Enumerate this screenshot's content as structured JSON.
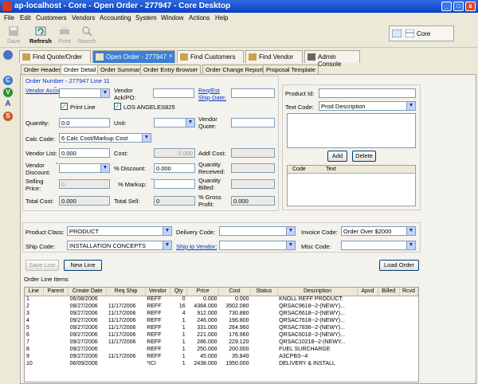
{
  "window": {
    "title": "ap-localhost - Core - Open Order - 277947 - Core Desktop"
  },
  "menu": [
    "File",
    "Edit",
    "Customers",
    "Vendors",
    "Accounting",
    "System",
    "Window",
    "Actions",
    "Help"
  ],
  "toolbar": {
    "save": "Save",
    "refresh": "Refresh",
    "print": "Print",
    "search": "Search",
    "company": "Core"
  },
  "doc_tabs": [
    "Find Quote/Order",
    "Open Order - 277947",
    "Find Customers",
    "Find Vendor",
    "Admin Console"
  ],
  "sub_tabs": [
    "Order Header",
    "Order Detail",
    "Order Summary",
    "Order Entry Browser",
    "Order Change Report",
    "Proposal Template"
  ],
  "detail": {
    "order_number": "Order Number - 277947 Line 11",
    "vendor_account_label": "Vendor Account:",
    "vendor_ackpo_label": "Vendor Ack/PO:",
    "req_ship_label": "Req/Est Ship Date:",
    "print_line_label": "Print Line",
    "los_angeles_label": "LOS ANGELES825",
    "quantity_label": "Quantity:",
    "quantity_value": "0.0",
    "unit_label": "Unit:",
    "vendor_quote_label": "Vendor Quote:",
    "calc_code_label": "Calc Code:",
    "calc_code_value": "6 Calc Cost/Markup Cost",
    "vendor_list_label": "Vendor List:",
    "vendor_list_value": "0.000",
    "cost_label": "Cost:",
    "cost_value": "0.000",
    "addl_cost_label": "Addl Cost:",
    "vendor_discount_label": "Vendor Discount:",
    "pct_discount_label": "% Discount:",
    "pct_discount_value": "0.000",
    "qty_received_label": "Quantity Received:",
    "selling_price_label": "Selling Price:",
    "selling_price_value": "0.",
    "pct_markup_label": "% Markup:",
    "qty_billed_label": "Quantity Billed:",
    "total_cost_label": "Total Cost:",
    "total_cost_value": "0.000",
    "total_sell_label": "Total Sell:",
    "total_sell_value": "0",
    "gross_profit_label": "% Gross Profit:",
    "gross_profit_value": "0.000",
    "product_id_label": "Product Id:",
    "text_code_label": "Text Code:",
    "text_code_value": "Prod Description",
    "add_button": "Add",
    "delete_button": "Delete",
    "code_col": "Code",
    "text_col": "Text",
    "product_class_label": "Product Class:",
    "product_class_value": "PRODUCT",
    "delivery_code_label": "Delivery Code:",
    "invoice_code_label": "Invoice Code:",
    "invoice_code_value": "Order Over $2000",
    "ship_code_label": "Ship Code:",
    "ship_code_value": "INSTALLATION CONCEPTS",
    "ship_to_vendor_label": "Ship to Vendor:",
    "misc_code_label": "Misc Code:",
    "save_line": "Save Line",
    "new_line": "New Line",
    "load_order": "Load Order",
    "order_line_items": "Order Line Items"
  },
  "grid": {
    "columns": [
      "Line",
      "Parent",
      "Create Date",
      "Req Ship",
      "Vendor",
      "Qty",
      "Price",
      "Cost",
      "Status",
      "Description",
      "Apvd",
      "Billed",
      "Rcvd"
    ],
    "rows": [
      [
        "1",
        "",
        "06/08/2006",
        "",
        "REFF",
        "0",
        "0.000",
        "0.000",
        "",
        "KNOLL REFF PRODUCT:",
        "",
        "",
        ""
      ],
      [
        "2",
        "",
        "09/27/2006",
        "11/17/2006",
        "REFF",
        "16",
        "4384.000",
        "3502.080",
        "",
        "QRSAC9618--2-(NEWY)...",
        "",
        "",
        ""
      ],
      [
        "3",
        "",
        "09/27/2006",
        "11/17/2006",
        "REFF",
        "4",
        "912.000",
        "730.880",
        "",
        "QRSAC6618--2-(NEWY)...",
        "",
        "",
        ""
      ],
      [
        "4",
        "",
        "09/27/2006",
        "11/17/2006",
        "REFF",
        "1",
        "246.000",
        "196.800",
        "",
        "QRSAC7618--2-(NEWY)...",
        "",
        "",
        ""
      ],
      [
        "5",
        "",
        "09/27/2006",
        "11/17/2006",
        "REFF",
        "1",
        "331.000",
        "264.960",
        "",
        "QRSAC7836--2-(NEWY)...",
        "",
        "",
        ""
      ],
      [
        "6",
        "",
        "09/27/2006",
        "11/17/2006",
        "REFF",
        "1",
        "221.000",
        "176.960",
        "",
        "QRSAC6018--2-(NEWY)...",
        "",
        "",
        ""
      ],
      [
        "7",
        "",
        "09/27/2006",
        "11/17/2006",
        "REFF",
        "1",
        "286.000",
        "229.120",
        "",
        "QRSAC10218--2-(NEWY...",
        "",
        "",
        ""
      ],
      [
        "8",
        "",
        "09/27/2006",
        "",
        "REFF",
        "1",
        "250.000",
        "200.000",
        "",
        "FUEL SURCHARGE",
        "",
        "",
        ""
      ],
      [
        "9",
        "",
        "09/27/2006",
        "11/17/2006",
        "REFF",
        "1",
        "45.000",
        "35.840",
        "",
        "A3CPBS--4",
        "",
        "",
        ""
      ],
      [
        "10",
        "",
        "06/09/2006",
        "",
        "*ICI",
        "1",
        "2438.000",
        "1950.000",
        "",
        "DELIVERY & INSTALL",
        "",
        "",
        ""
      ]
    ]
  },
  "colors": {
    "titlebar": "#0a3fc2",
    "active_tab": "#3b7fd6",
    "link": "#0033cc"
  },
  "icons": [
    "save-icon",
    "refresh-icon",
    "print-icon",
    "search-icon",
    "core-icon"
  ]
}
